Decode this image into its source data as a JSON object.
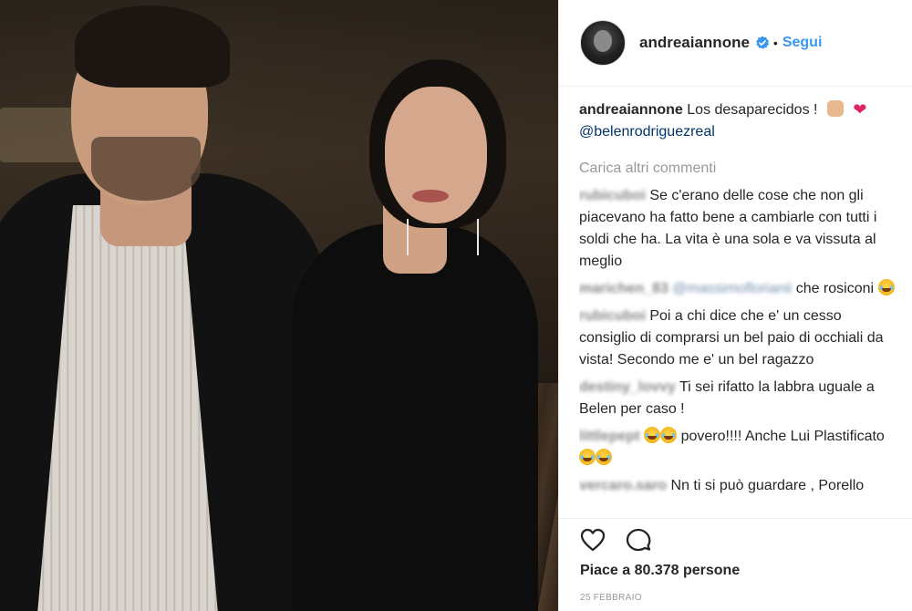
{
  "post": {
    "username": "andreaiannone",
    "follow_label": "Segui",
    "separator": "•"
  },
  "caption": {
    "username": "andreaiannone",
    "text": "Los desaparecidos !",
    "mention": "@belenrodriguezreal"
  },
  "load_more": "Carica altri commenti",
  "comments": [
    {
      "username": "rubicuboi",
      "text": "Se c'erano delle cose che non gli piacevano ha fatto bene a cambiarle con tutti i soldi che ha. La vita è una sola e va vissuta al meglio"
    },
    {
      "username": "marichen_83",
      "mention": "@massimoflorianii",
      "text": "che rosiconi"
    },
    {
      "username": "rubicuboi",
      "text": "Poi a chi dice che e' un cesso consiglio di comprarsi un bel paio di occhiali da vista! Secondo me e' un bel ragazzo"
    },
    {
      "username": "destiny_lovvy",
      "text": "Ti sei rifatto la labbra uguale a Belen per caso !"
    },
    {
      "username": "littlepept",
      "text": "povero!!!! Anche Lui Plastificato"
    },
    {
      "username": "vercaro.saro",
      "text": "Nn ti si può guardare , Porello"
    }
  ],
  "likes": "Piace a 80.378 persone",
  "date": "25 FEBBRAIO",
  "colors": {
    "accent": "#3897f0",
    "text": "#262626",
    "muted": "#999999",
    "border": "#efefef"
  },
  "icons": [
    "verified-badge-icon",
    "heart-icon",
    "comment-icon"
  ]
}
